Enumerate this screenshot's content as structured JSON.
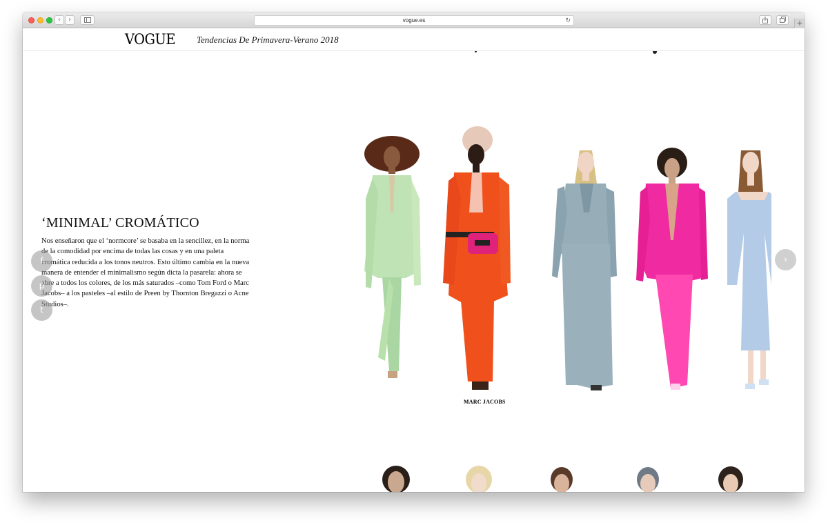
{
  "browser": {
    "url": "vogue.es",
    "back_icon": "chevron-left-icon",
    "forward_icon": "chevron-right-icon",
    "sidebar_icon": "sidebar-icon",
    "reload_icon": "reload-icon",
    "share_icon": "share-icon",
    "tabs_icon": "tabs-icon",
    "new_tab_icon": "plus-icon"
  },
  "header": {
    "logo": "VOGUE",
    "title": "Tendencias De Primavera-Verano 2018"
  },
  "article": {
    "title": "‘MINIMAL’ CROMÁTICO",
    "body": "Nos enseñaron que el ‘normcore’ se basaba en la sencillez, en la norma de la comodidad por encima de todas las cosas y en una paleta cromática reducida a los tonos neutros. Esto último cambia en la nueva manera de entender el minimalismo según dicta la pasarela: ahora se abre a todos los colores, de los más saturados –como Tom Ford o Marc Jacobs– a los pasteles –al estilo de Preen by Thornton Bregazzi o Acne Studios–."
  },
  "share": {
    "facebook_glyph": "f",
    "pinterest_glyph": "p",
    "tumblr_glyph": "t"
  },
  "gallery": {
    "caption": "MARC JACOBS",
    "next_glyph": "›",
    "colors": {
      "mint_suit": "#bfe3b4",
      "orange_suit": "#f0511c",
      "grey_blue_suit": "#97aeb9",
      "pink_suit": "#f02aa0",
      "light_blue_dress": "#b3cbe6"
    }
  }
}
